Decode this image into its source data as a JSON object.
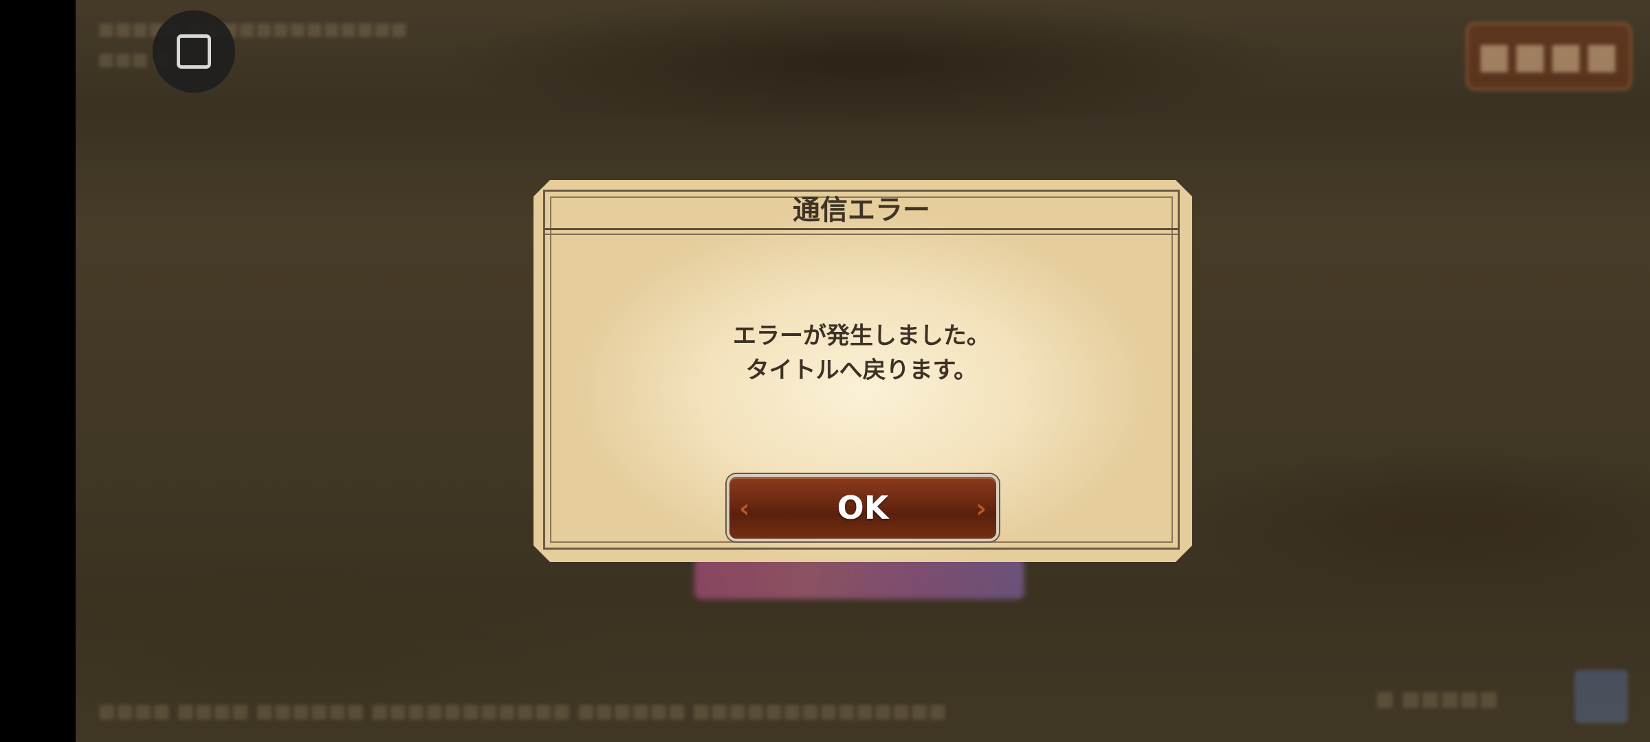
{
  "dialog": {
    "title": "通信エラー",
    "message_line1": "エラーが発生しました。",
    "message_line2": "タイトルへ戻ります。",
    "ok_label": "OK"
  },
  "icons": {
    "overview_button": "square-icon",
    "ok_left": "chevron-left-icon",
    "ok_right": "chevron-right-icon"
  },
  "colors": {
    "dialog_paper": "#f3e2bc",
    "dialog_text": "#3b3124",
    "button_brown": "#6e2a12",
    "button_text": "#ffffff"
  }
}
